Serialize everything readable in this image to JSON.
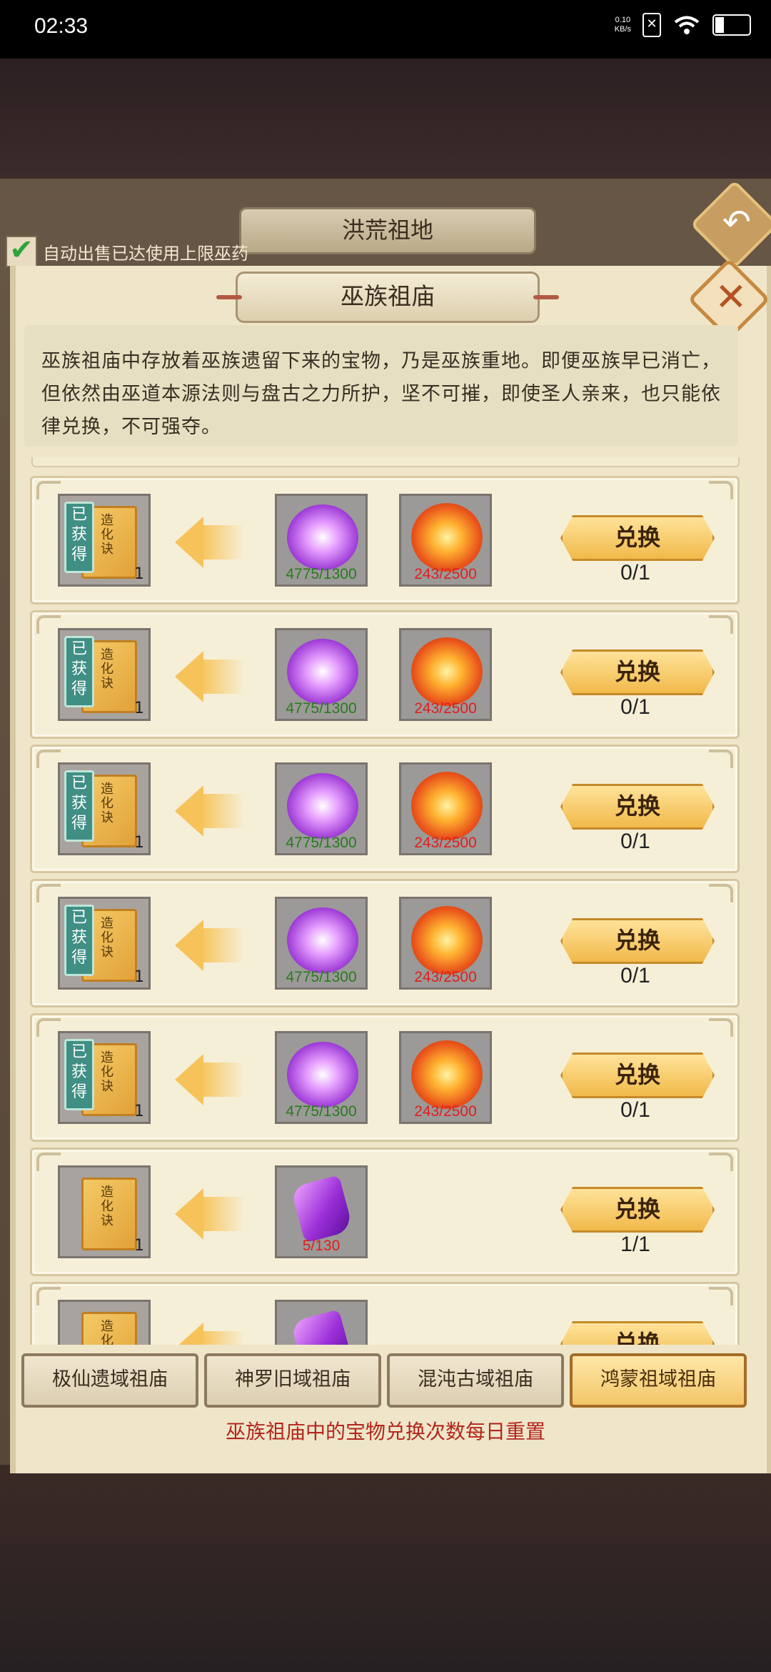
{
  "status_bar": {
    "time": "02:33",
    "net_speed_top": "0.10",
    "net_speed_bottom": "KB/s",
    "battery": "25",
    "battery_level": 0.25
  },
  "outer": {
    "title": "洪荒祖地",
    "auto_sell_label": "自动出售已达使用上限巫药"
  },
  "panel": {
    "title": "巫族祖庙",
    "description": "巫族祖庙中存放着巫族遗留下来的宝物，乃是巫族重地。即便巫族早已消亡，但依然由巫道本源法则与盘古之力所护，坚不可摧，即使圣人亲来，也只能依律兑换，不可强夺。"
  },
  "rows": [
    {
      "reward_name": "造化诀",
      "obtained_label": "已获得",
      "reward_qty": "1",
      "cost1": "4775/1300",
      "cost2": "243/2500",
      "button": "兑换",
      "limit": "0/1"
    },
    {
      "reward_name": "造化诀",
      "obtained_label": "已获得",
      "reward_qty": "1",
      "cost1": "4775/1300",
      "cost2": "243/2500",
      "button": "兑换",
      "limit": "0/1"
    },
    {
      "reward_name": "造化诀",
      "obtained_label": "已获得",
      "reward_qty": "1",
      "cost1": "4775/1300",
      "cost2": "243/2500",
      "button": "兑换",
      "limit": "0/1"
    },
    {
      "reward_name": "造化诀",
      "obtained_label": "已获得",
      "reward_qty": "1",
      "cost1": "4775/1300",
      "cost2": "243/2500",
      "button": "兑换",
      "limit": "0/1"
    },
    {
      "reward_name": "造化诀",
      "obtained_label": "已获得",
      "reward_qty": "1",
      "cost1": "4775/1300",
      "cost2": "243/2500",
      "button": "兑换",
      "limit": "0/1"
    },
    {
      "reward_name": "造化诀",
      "reward_qty": "1",
      "cost1": "5/130",
      "button": "兑换",
      "limit": "1/1"
    },
    {
      "reward_name": "造化诀",
      "button": "兑换"
    }
  ],
  "tabs": [
    {
      "label": "极仙遗域祖庙"
    },
    {
      "label": "神罗旧域祖庙"
    },
    {
      "label": "混沌古域祖庙"
    },
    {
      "label": "鸿蒙祖域祖庙",
      "active": true
    }
  ],
  "footer_note": "巫族祖庙中的宝物兑换次数每日重置",
  "colors": {
    "cost_ok": "#2a7a1e",
    "cost_short": "#e01e1e",
    "footer": "#b3261e"
  }
}
